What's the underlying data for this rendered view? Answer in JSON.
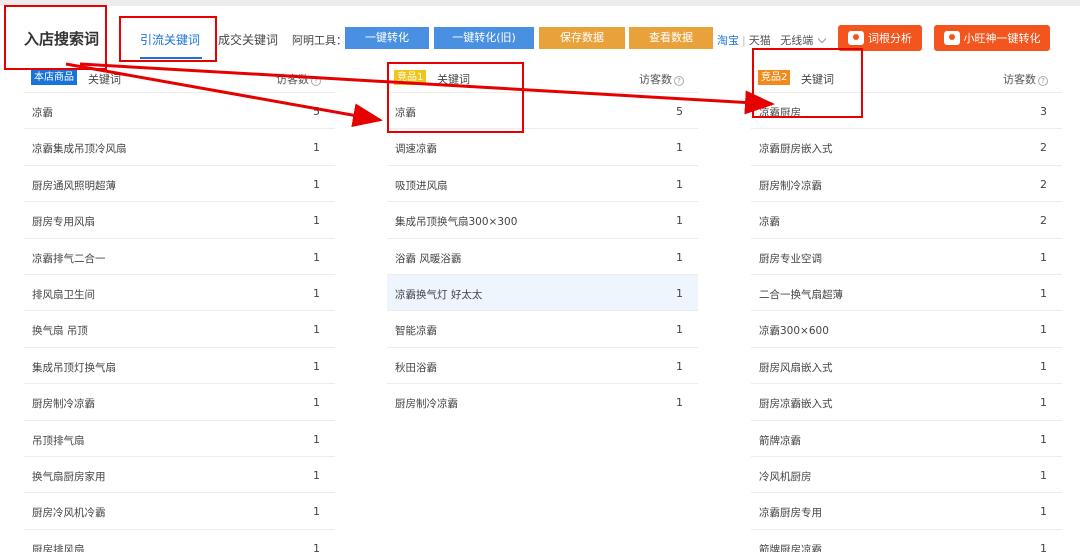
{
  "header": {
    "page_title": "入店搜索词",
    "tabs": [
      {
        "label": "引流关键词",
        "active": true
      },
      {
        "label": "成交关键词",
        "active": false
      }
    ],
    "tools_label": "阿明工具：",
    "tool_buttons": [
      "一键转化",
      "一键转化(旧)",
      "保存数据",
      "查看数据"
    ],
    "platform": {
      "taobao": "淘宝",
      "separator": "|",
      "tmall": "天猫",
      "device": "无线端"
    },
    "right_buttons": [
      "词根分析",
      "小旺神一键转化"
    ]
  },
  "columns": [
    {
      "badge": "本店商品",
      "keyword_header": "关键词",
      "visitors_header": "访客数",
      "rows": [
        {
          "keyword": "凉霸",
          "visitors": "5"
        },
        {
          "keyword": "凉霸集成吊顶冷风扇",
          "visitors": "1"
        },
        {
          "keyword": "厨房通风照明超薄",
          "visitors": "1"
        },
        {
          "keyword": "厨房专用风扇",
          "visitors": "1"
        },
        {
          "keyword": "凉霸排气二合一",
          "visitors": "1"
        },
        {
          "keyword": "排风扇卫生间",
          "visitors": "1"
        },
        {
          "keyword": "换气扇 吊顶",
          "visitors": "1"
        },
        {
          "keyword": "集成吊顶灯换气扇",
          "visitors": "1"
        },
        {
          "keyword": "厨房制冷凉霸",
          "visitors": "1"
        },
        {
          "keyword": "吊顶排气扇",
          "visitors": "1"
        },
        {
          "keyword": "换气扇厨房家用",
          "visitors": "1"
        },
        {
          "keyword": "厨房冷风机冷霸",
          "visitors": "1"
        },
        {
          "keyword": "厨房排风扇",
          "visitors": "1"
        }
      ]
    },
    {
      "badge": "竞品1",
      "keyword_header": "关键词",
      "visitors_header": "访客数",
      "rows": [
        {
          "keyword": "凉霸",
          "visitors": "5"
        },
        {
          "keyword": "调速凉霸",
          "visitors": "1"
        },
        {
          "keyword": "吸顶进风扇",
          "visitors": "1"
        },
        {
          "keyword": "集成吊顶换气扇300×300",
          "visitors": "1"
        },
        {
          "keyword": "浴霸 风暖浴霸",
          "visitors": "1"
        },
        {
          "keyword": "凉霸换气灯 好太太",
          "visitors": "1"
        },
        {
          "keyword": "智能凉霸",
          "visitors": "1"
        },
        {
          "keyword": "秋田浴霸",
          "visitors": "1"
        },
        {
          "keyword": "厨房制冷凉霸",
          "visitors": "1"
        }
      ]
    },
    {
      "badge": "竞品2",
      "keyword_header": "关键词",
      "visitors_header": "访客数",
      "rows": [
        {
          "keyword": "凉霸厨房",
          "visitors": "3"
        },
        {
          "keyword": "凉霸厨房嵌入式",
          "visitors": "2"
        },
        {
          "keyword": "厨房制冷凉霸",
          "visitors": "2"
        },
        {
          "keyword": "凉霸",
          "visitors": "2"
        },
        {
          "keyword": "厨房专业空调",
          "visitors": "1"
        },
        {
          "keyword": "二合一换气扇超薄",
          "visitors": "1"
        },
        {
          "keyword": "凉霸300×600",
          "visitors": "1"
        },
        {
          "keyword": "厨房风扇嵌入式",
          "visitors": "1"
        },
        {
          "keyword": "厨房凉霸嵌入式",
          "visitors": "1"
        },
        {
          "keyword": "箭牌凉霸",
          "visitors": "1"
        },
        {
          "keyword": "冷风机厨房",
          "visitors": "1"
        },
        {
          "keyword": "凉霸厨房专用",
          "visitors": "1"
        },
        {
          "keyword": "箭牌厨房凉霸",
          "visitors": "1"
        }
      ]
    }
  ],
  "annotation_color": "#e60000"
}
